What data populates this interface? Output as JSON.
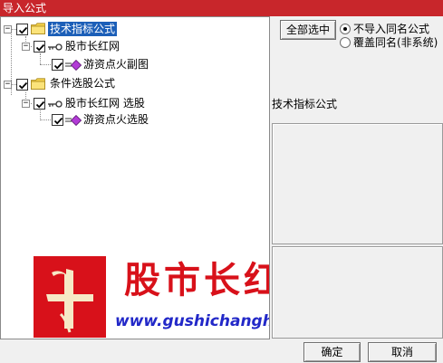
{
  "window": {
    "title": "导入公式"
  },
  "tree": {
    "nodes": [
      {
        "label": "技术指标公式",
        "selected": true
      },
      {
        "label": "股市长红网"
      },
      {
        "label": "游资点火副图"
      },
      {
        "label": "条件选股公式"
      },
      {
        "label": "股市长红网 选股"
      },
      {
        "label": "游资点火选股"
      }
    ]
  },
  "watermark": {
    "logo_char": "牛",
    "brand": "股市长红",
    "url": "www.gushichanghong.com"
  },
  "options": {
    "select_all_label": "全部选中",
    "radio_options": [
      {
        "label": "不导入同名公式",
        "checked": true
      },
      {
        "label": "覆盖同名(非系统)",
        "checked": false
      }
    ]
  },
  "description": {
    "title": "技术指标公式"
  },
  "buttons": {
    "ok": "确定",
    "cancel": "取消"
  },
  "colors": {
    "titlebar": "#c8262b",
    "selection": "#1c5fb8",
    "brand_red": "#d8111a",
    "url_blue": "#2228c8"
  }
}
